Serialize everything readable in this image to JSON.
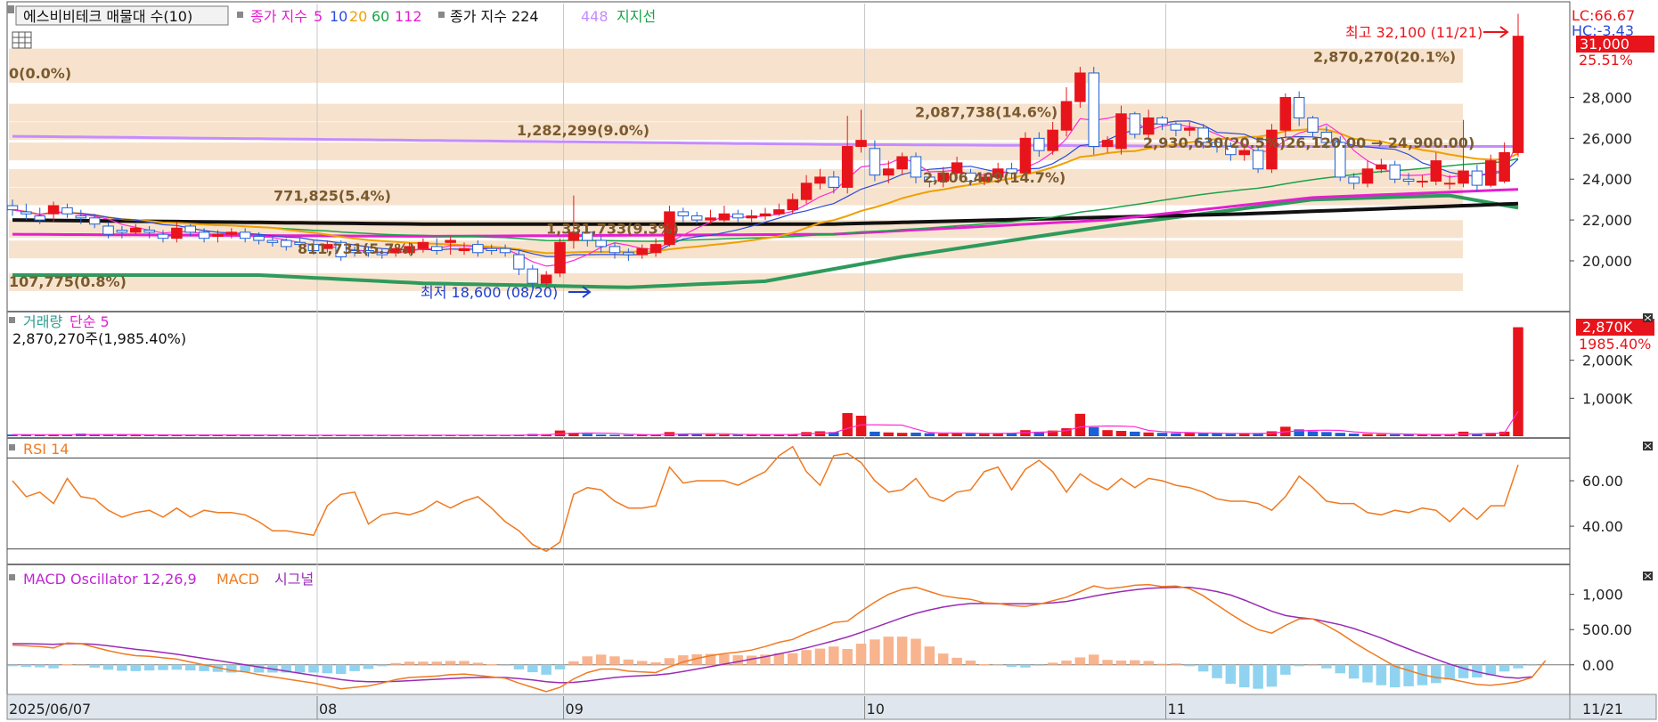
{
  "colors": {
    "up": "#e8141b",
    "down": "#1c5fd6",
    "ma5": "#ff2bd6",
    "ma10": "#2a4bd8",
    "ma20": "#f0a000",
    "ma60": "#1aa34a",
    "ma112": "#e41fd0",
    "ma224": "#111111",
    "ma448": "#c48cff",
    "support": "#2e9a5c",
    "band": "#f7e3cd",
    "rsi": "#f07a20",
    "macd": "#f07a20",
    "signal": "#9a2bb5",
    "osc_pos": "#f8b48e",
    "osc_neg": "#8fd3f0",
    "vol_ma": "#ff2bd6"
  },
  "price_panel": {
    "legend": {
      "series": "에스비비테크 매물대 수(10)",
      "ma_label": "종가 지수",
      "ma5": "5",
      "ma10": "10",
      "ma20": "20",
      "ma60": "60",
      "ma112": "112",
      "ma224_label": "종가 지수 224",
      "ma448": "448",
      "support": "지지선"
    },
    "right_labels": {
      "lc": "LC:66.67",
      "hc": "HC:-3.43",
      "current": "31,000",
      "pct": "25.51%"
    },
    "high_annot": "최고 32,100 (11/21)",
    "low_annot": "최저 18,600 (08/20)",
    "ma_value_annot": "2,930,630(20.5%)26,120.00 → 24,900.00)",
    "volume_profile": [
      {
        "label": "2,870,270(20.1%)",
        "price": 30000
      },
      {
        "label": "0(0.0%)",
        "price": 29200
      },
      {
        "label": "2,087,738(14.6%)",
        "price": 27300
      },
      {
        "label": "1,282,299(9.0%)",
        "price": 26400
      },
      {
        "label": "",
        "price": 25400
      },
      {
        "label": "2,106,409(14.7%)",
        "price": 24100
      },
      {
        "label": "771,825(5.4%)",
        "price": 23200
      },
      {
        "label": "1,331,733(9.3%)",
        "price": 21600
      },
      {
        "label": "811,731(5.7%)",
        "price": 20600
      },
      {
        "label": "107,775(0.8%)",
        "price": 19000
      }
    ]
  },
  "volume_panel": {
    "legend_a": "거래량",
    "legend_b": "단순 5",
    "info": "2,870,270주(1,985.40%)",
    "right_a": "2,870K",
    "right_b": "1985.40%"
  },
  "rsi_panel": {
    "legend": "RSI 14"
  },
  "macd_panel": {
    "legend_a": "MACD Oscillator 12,26,9",
    "legend_b": "MACD",
    "legend_c": "시그널"
  },
  "x_axis": {
    "ticks": [
      "2025/06/07",
      "08",
      "09",
      "10",
      "11"
    ],
    "right": "11/21"
  },
  "chart_data": [
    {
      "type": "candlestick",
      "title": "에스비비테크 매물대 수(10)",
      "x": [
        "06/07",
        "08",
        "09",
        "10",
        "11",
        "11/21"
      ],
      "y_ticks": [
        20000,
        22000,
        24000,
        26000,
        28000
      ],
      "ylim": [
        17600,
        32600
      ],
      "open": [
        22700,
        22400,
        22200,
        22300,
        22600,
        22200,
        22100,
        21700,
        21500,
        21400,
        21500,
        21300,
        21100,
        21700,
        21400,
        21200,
        21300,
        21400,
        21200,
        21000,
        21000,
        20900,
        20800,
        20600,
        20900,
        20500,
        20500,
        20400,
        20400,
        20400,
        20600,
        20700,
        20900,
        20500,
        20800,
        20600,
        20600,
        20300,
        19600,
        18900,
        19400,
        21000,
        21400,
        21000,
        20700,
        20400,
        20300,
        20400,
        20800,
        22400,
        22200,
        22000,
        22000,
        22300,
        22100,
        22200,
        22300,
        22500,
        23000,
        23800,
        24100,
        23600,
        25600,
        25500,
        24200,
        24500,
        25100,
        24100,
        23900,
        24300,
        24300,
        23900,
        24100,
        24500,
        24300,
        26000,
        25400,
        26400,
        27800,
        29200,
        25600,
        25500,
        27200,
        26200,
        27000,
        26700,
        26400,
        26500,
        25800,
        25600,
        25200,
        25400,
        24500,
        26400,
        28000,
        27000,
        26300,
        25800,
        24100,
        23800,
        24500,
        24700,
        24000,
        23900,
        23900,
        23800,
        23800,
        24400,
        23700,
        23900,
        25300
      ],
      "close": [
        22500,
        22300,
        22000,
        22700,
        22300,
        22100,
        21800,
        21300,
        21400,
        21600,
        21400,
        21100,
        21600,
        21400,
        21100,
        21300,
        21400,
        21100,
        21000,
        20900,
        20700,
        20800,
        20500,
        20800,
        20200,
        20400,
        20400,
        20300,
        20600,
        20700,
        20900,
        20500,
        21000,
        20600,
        20400,
        20500,
        20400,
        19600,
        18900,
        19300,
        20900,
        21400,
        21000,
        20700,
        20400,
        20300,
        20600,
        20800,
        22400,
        22200,
        22000,
        22100,
        22300,
        22100,
        22200,
        22300,
        22500,
        23000,
        23800,
        24100,
        23600,
        25600,
        25900,
        24200,
        24500,
        25100,
        24100,
        23900,
        24300,
        24800,
        23900,
        24100,
        24500,
        24300,
        26000,
        25400,
        26400,
        27800,
        29200,
        25600,
        25900,
        27200,
        26200,
        27000,
        26700,
        26400,
        26500,
        25800,
        25600,
        25200,
        25400,
        24500,
        26400,
        28000,
        27000,
        26300,
        25800,
        24100,
        23800,
        24500,
        24700,
        24000,
        23900,
        23900,
        24900,
        23800,
        24400,
        23700,
        24900,
        25300,
        31000
      ],
      "high": [
        23000,
        22800,
        22600,
        22900,
        22800,
        22500,
        22300,
        21900,
        21700,
        21800,
        21700,
        21500,
        21900,
        21800,
        21600,
        21500,
        21600,
        21600,
        21400,
        21200,
        21100,
        21100,
        21000,
        21000,
        21000,
        20700,
        20700,
        20600,
        20800,
        20900,
        21100,
        21100,
        21200,
        20900,
        21000,
        20800,
        20800,
        20500,
        19800,
        19500,
        21100,
        23200,
        21600,
        21200,
        20900,
        20600,
        20800,
        21100,
        22700,
        22600,
        22400,
        22500,
        22700,
        22500,
        22500,
        22600,
        22800,
        23300,
        24200,
        24500,
        24400,
        27100,
        27400,
        25900,
        24900,
        25300,
        25300,
        24300,
        24600,
        25100,
        24500,
        24300,
        24800,
        24800,
        26300,
        26300,
        26800,
        28500,
        29500,
        29500,
        26100,
        27600,
        27300,
        27400,
        27100,
        26800,
        26800,
        26700,
        26000,
        25800,
        25700,
        25600,
        26700,
        28200,
        28300,
        27100,
        26600,
        26100,
        24300,
        24900,
        25000,
        24900,
        24300,
        24200,
        25300,
        24200,
        26900,
        24700,
        25200,
        25800,
        32100
      ],
      "low": [
        22200,
        22000,
        21800,
        21900,
        22100,
        21800,
        21600,
        21100,
        21100,
        21300,
        21100,
        20900,
        20900,
        21200,
        20900,
        20900,
        21100,
        20900,
        20800,
        20700,
        20500,
        20600,
        20300,
        20400,
        20000,
        20200,
        20200,
        20100,
        20200,
        20300,
        20400,
        20300,
        20300,
        20300,
        20200,
        20300,
        20200,
        19300,
        18600,
        18800,
        19200,
        20600,
        20700,
        20400,
        20100,
        20000,
        20100,
        20200,
        20700,
        21900,
        21800,
        21800,
        21900,
        21900,
        21900,
        22000,
        22200,
        22300,
        22800,
        23500,
        23300,
        23300,
        25300,
        23900,
        23800,
        24200,
        23800,
        23600,
        23600,
        24000,
        23700,
        23700,
        23800,
        24000,
        24100,
        25100,
        25200,
        26100,
        27500,
        25200,
        25300,
        25200,
        26000,
        26000,
        26400,
        26100,
        26100,
        25500,
        25300,
        24900,
        24900,
        24300,
        24300,
        26000,
        26600,
        26100,
        25500,
        23900,
        23500,
        23600,
        24300,
        23800,
        23700,
        23600,
        23700,
        23500,
        23600,
        23400,
        23600,
        23800,
        25100
      ],
      "volume": [
        45,
        40,
        38,
        42,
        35,
        70,
        40,
        38,
        36,
        34,
        32,
        30,
        34,
        36,
        33,
        31,
        30,
        30,
        32,
        29,
        28,
        27,
        29,
        30,
        28,
        27,
        26,
        25,
        26,
        27,
        28,
        30,
        29,
        28,
        27,
        25,
        24,
        40,
        60,
        55,
        150,
        90,
        65,
        45,
        40,
        35,
        38,
        40,
        110,
        70,
        55,
        50,
        45,
        40,
        42,
        45,
        50,
        60,
        110,
        130,
        110,
        610,
        540,
        120,
        100,
        90,
        95,
        80,
        70,
        85,
        75,
        70,
        80,
        90,
        160,
        120,
        150,
        210,
        590,
        240,
        160,
        140,
        120,
        100,
        90,
        80,
        85,
        80,
        70,
        65,
        75,
        70,
        130,
        250,
        180,
        130,
        110,
        90,
        70,
        60,
        55,
        50,
        45,
        40,
        50,
        45,
        120,
        60,
        90,
        120,
        2870
      ],
      "rsi": [
        60,
        53,
        55,
        50,
        61,
        53,
        52,
        47,
        44,
        46,
        47,
        44,
        48,
        44,
        47,
        46,
        46,
        45,
        42,
        38,
        38,
        37,
        36,
        49,
        54,
        55,
        41,
        45,
        46,
        45,
        47,
        51,
        48,
        51,
        53,
        48,
        42,
        38,
        32,
        29,
        33,
        54,
        57,
        56,
        51,
        48,
        48,
        49,
        66,
        59,
        60,
        60,
        60,
        58,
        61,
        64,
        71,
        75,
        64,
        58,
        71,
        72,
        68,
        60,
        55,
        56,
        61,
        53,
        51,
        55,
        56,
        64,
        66,
        56,
        65,
        69,
        64,
        55,
        63,
        59,
        56,
        61,
        57,
        61,
        60,
        58,
        57,
        55,
        52,
        51,
        51,
        50,
        47,
        53,
        62,
        57,
        51,
        50,
        50,
        46,
        45,
        47,
        46,
        48,
        47,
        42,
        48,
        43,
        49,
        49,
        67
      ],
      "macd": [
        280,
        270,
        260,
        240,
        310,
        300,
        250,
        200,
        160,
        130,
        120,
        100,
        80,
        40,
        0,
        -40,
        -80,
        -100,
        -140,
        -170,
        -200,
        -230,
        -260,
        -300,
        -340,
        -320,
        -300,
        -260,
        -210,
        -180,
        -170,
        -160,
        -140,
        -130,
        -150,
        -170,
        -190,
        -260,
        -320,
        -380,
        -320,
        -200,
        -110,
        -60,
        -60,
        -90,
        -100,
        -110,
        -30,
        40,
        90,
        130,
        160,
        180,
        210,
        260,
        320,
        360,
        450,
        520,
        600,
        620,
        760,
        890,
        1000,
        1070,
        1100,
        1040,
        980,
        950,
        930,
        880,
        870,
        840,
        830,
        860,
        910,
        960,
        1040,
        1120,
        1080,
        1100,
        1130,
        1140,
        1110,
        1120,
        1080,
        980,
        850,
        720,
        600,
        500,
        450,
        560,
        650,
        650,
        560,
        450,
        320,
        200,
        90,
        -20,
        -80,
        -140,
        -180,
        -200,
        -240,
        -280,
        -290,
        -270,
        -240,
        -180,
        60
      ],
      "signal": [
        300,
        300,
        295,
        290,
        300,
        300,
        290,
        270,
        245,
        220,
        200,
        175,
        150,
        120,
        90,
        60,
        30,
        0,
        -30,
        -60,
        -90,
        -120,
        -150,
        -180,
        -210,
        -230,
        -240,
        -240,
        -235,
        -225,
        -215,
        -205,
        -195,
        -185,
        -180,
        -178,
        -180,
        -195,
        -215,
        -240,
        -255,
        -250,
        -230,
        -205,
        -180,
        -165,
        -155,
        -145,
        -125,
        -95,
        -60,
        -25,
        10,
        45,
        80,
        115,
        155,
        195,
        240,
        290,
        340,
        395,
        460,
        530,
        600,
        670,
        730,
        780,
        820,
        850,
        870,
        870,
        868,
        868,
        868,
        868,
        880,
        900,
        935,
        975,
        1010,
        1040,
        1065,
        1085,
        1095,
        1100,
        1100,
        1075,
        1040,
        990,
        920,
        840,
        760,
        700,
        670,
        650,
        610,
        570,
        515,
        450,
        380,
        300,
        225,
        150,
        80,
        10,
        -50,
        -100,
        -140,
        -175,
        -190,
        -170
      ]
    }
  ]
}
